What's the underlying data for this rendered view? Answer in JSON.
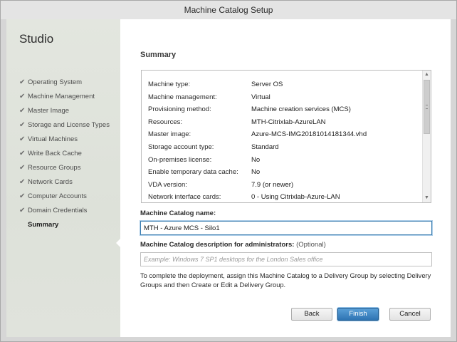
{
  "window": {
    "title": "Machine Catalog Setup"
  },
  "sidebar": {
    "title": "Studio",
    "steps": [
      {
        "label": "Operating System",
        "done": true
      },
      {
        "label": "Machine Management",
        "done": true
      },
      {
        "label": "Master Image",
        "done": true
      },
      {
        "label": "Storage and License Types",
        "done": true
      },
      {
        "label": "Virtual Machines",
        "done": true
      },
      {
        "label": "Write Back Cache",
        "done": true
      },
      {
        "label": "Resource Groups",
        "done": true
      },
      {
        "label": "Network Cards",
        "done": true
      },
      {
        "label": "Computer Accounts",
        "done": true
      },
      {
        "label": "Domain Credentials",
        "done": true
      },
      {
        "label": "Summary",
        "done": false,
        "current": true
      }
    ],
    "check_glyph": "✔"
  },
  "main": {
    "section_title": "Summary",
    "summary": [
      {
        "key": "Machine type:",
        "value": "Server OS"
      },
      {
        "key": "Machine management:",
        "value": "Virtual"
      },
      {
        "key": "Provisioning method:",
        "value": "Machine creation services (MCS)"
      },
      {
        "key": "Resources:",
        "value": "MTH-Citrixlab-AzureLAN"
      },
      {
        "key": "Master image:",
        "value": "Azure-MCS-IMG20181014181344.vhd"
      },
      {
        "key": "Storage account type:",
        "value": "Standard"
      },
      {
        "key": "On-premises license:",
        "value": "No"
      },
      {
        "key": "Enable temporary data cache:",
        "value": "No"
      },
      {
        "key": "VDA version:",
        "value": "7.9 (or newer)"
      },
      {
        "key": "Network interface cards:",
        "value": "0 - Using Citrixlab-Azure-LAN"
      }
    ],
    "catalog_name_label": "Machine Catalog name:",
    "catalog_name_value": "MTH - Azure MCS - Silo1",
    "description_label": "Machine Catalog description for administrators:",
    "description_optional": "(Optional)",
    "description_placeholder": "Example: Windows 7 SP1 desktops for the London Sales office",
    "info_text": "To complete the deployment, assign this Machine Catalog to a Delivery Group by selecting Delivery Groups and then Create or Edit a Delivery Group."
  },
  "buttons": {
    "back": "Back",
    "finish": "Finish",
    "cancel": "Cancel"
  },
  "colors": {
    "accent": "#2f74b3",
    "sidebar_bg": "#e0e3dc"
  }
}
